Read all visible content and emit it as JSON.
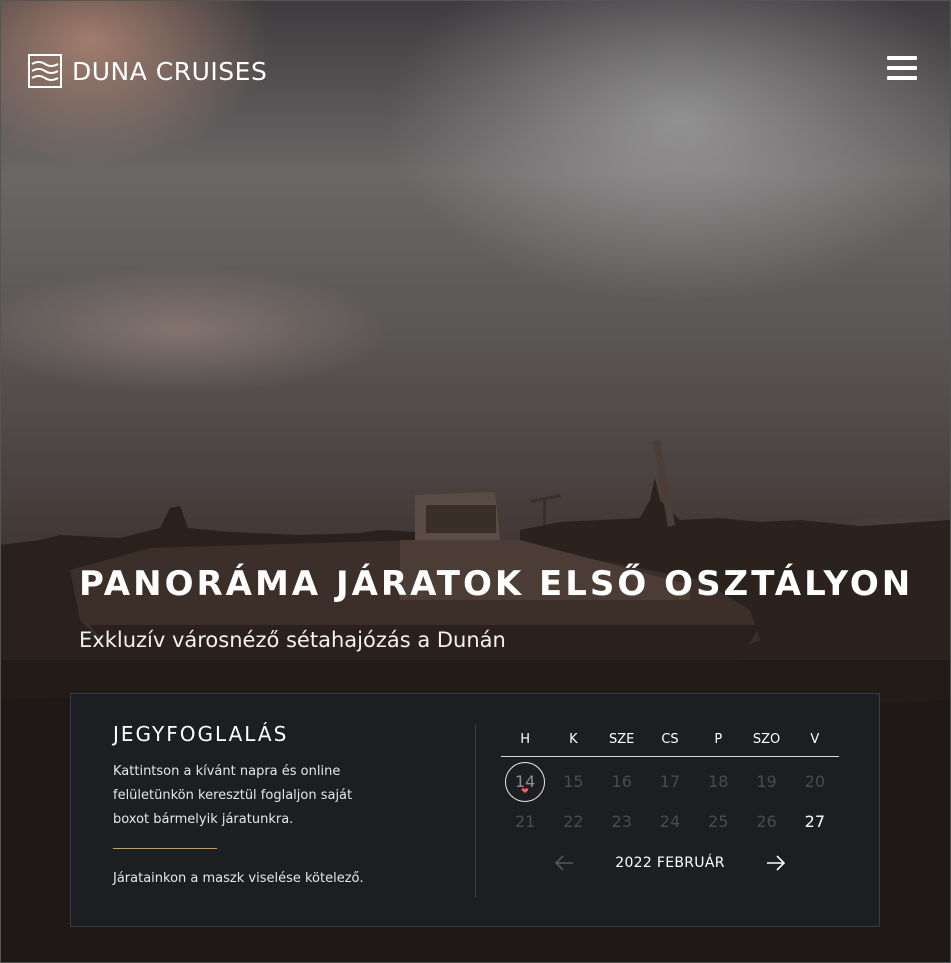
{
  "brand": {
    "name": "DUNA CRUISES",
    "logo_icon": "waves-icon"
  },
  "nav": {
    "menu_icon": "hamburger-menu-icon"
  },
  "hero": {
    "title": "PANORÁMA JÁRATOK ELSŐ OSZTÁLYON",
    "subtitle": "Exkluzív városnéző sétahajózás a Dunán"
  },
  "booking": {
    "title": "JEGYFOGLALÁS",
    "description": "Kattintson a kívánt napra és online felületünkön keresztül foglaljon saját boxot bármelyik járatunkra.",
    "note": "Járatainkon a maszk viselése kötelező.",
    "accent_color": "#c9a24a"
  },
  "calendar": {
    "weekdays": [
      "H",
      "K",
      "SZE",
      "CS",
      "P",
      "SZO",
      "V"
    ],
    "weeks": [
      [
        {
          "day": "14",
          "state": "today"
        },
        {
          "day": "15",
          "state": "disabled"
        },
        {
          "day": "16",
          "state": "disabled"
        },
        {
          "day": "17",
          "state": "disabled"
        },
        {
          "day": "18",
          "state": "disabled"
        },
        {
          "day": "19",
          "state": "disabled"
        },
        {
          "day": "20",
          "state": "disabled"
        }
      ],
      [
        {
          "day": "21",
          "state": "disabled"
        },
        {
          "day": "22",
          "state": "disabled"
        },
        {
          "day": "23",
          "state": "disabled"
        },
        {
          "day": "24",
          "state": "disabled"
        },
        {
          "day": "25",
          "state": "disabled"
        },
        {
          "day": "26",
          "state": "disabled"
        },
        {
          "day": "27",
          "state": "available"
        }
      ]
    ],
    "month_label": "2022 FEBRUÁR",
    "today_marker_color": "#ff5a5f",
    "prev_icon": "arrow-left-icon",
    "next_icon": "arrow-right-icon"
  }
}
